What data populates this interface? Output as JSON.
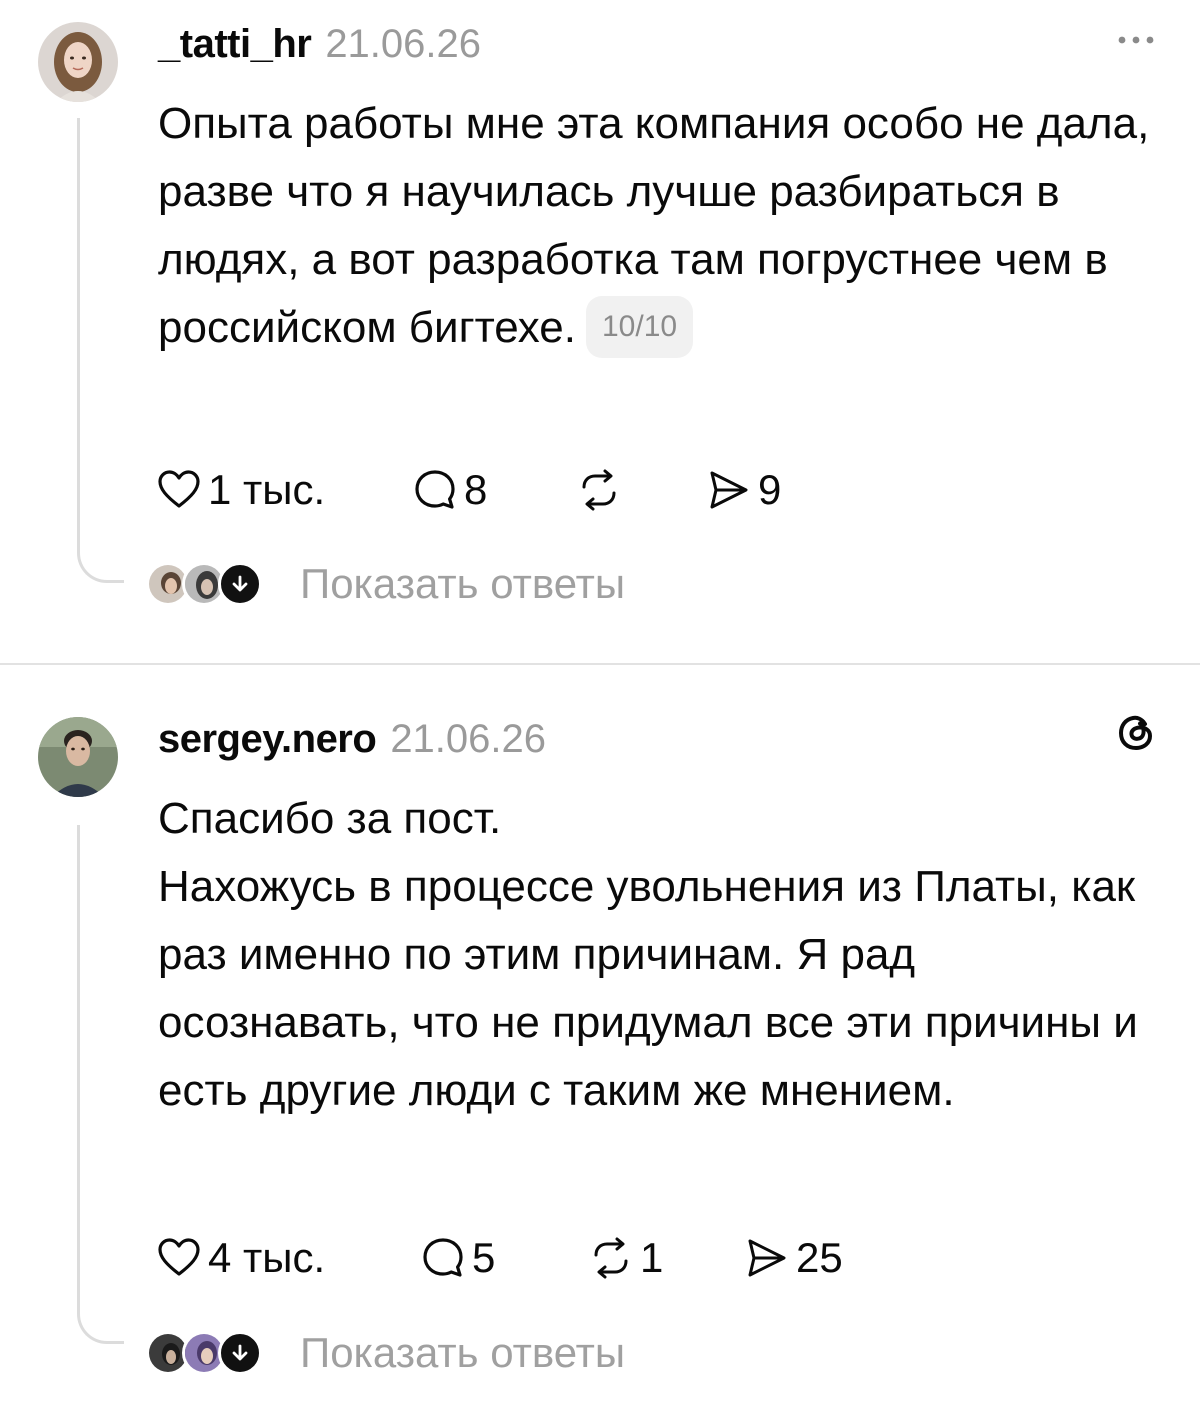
{
  "posts": [
    {
      "username": "_tatti_hr",
      "date": "21.06.26",
      "body": [
        "Опыта работы мне эта компания особо не дала, разве что я научилась лучше разбираться в людях, а вот разработка там погрустнее чем в российском бигтехе."
      ],
      "tag": "10/10",
      "likes": "1 тыс.",
      "comments": "8",
      "reposts": "",
      "shares": "9",
      "show_replies": "Показать ответы",
      "avatar_colors": {
        "bg": "#d9d3cf",
        "hair": "#7a5a40",
        "face": "#efd6c8"
      },
      "corner_icon": "more-icon"
    },
    {
      "username": "sergey.nero",
      "date": "21.06.26",
      "body": [
        "Спасибо за пост.",
        "Нахожусь в процессе увольнения из Платы, как раз именно по этим причинам. Я рад осознавать, что не придумал все эти причины и есть другие люди с таким же мнением."
      ],
      "tag": "",
      "likes": "4 тыс.",
      "comments": "5",
      "reposts": "1",
      "shares": "25",
      "show_replies": "Показать ответы",
      "avatar_colors": {
        "bg": "#7d8a74",
        "hair": "#2b2420",
        "face": "#d8b8a2"
      },
      "corner_icon": "threads-icon"
    }
  ],
  "colors": {
    "text": "#0a0a0a",
    "muted": "#9a9a9a",
    "line": "#dcdcdc",
    "tag_bg": "#f1f1f1"
  }
}
